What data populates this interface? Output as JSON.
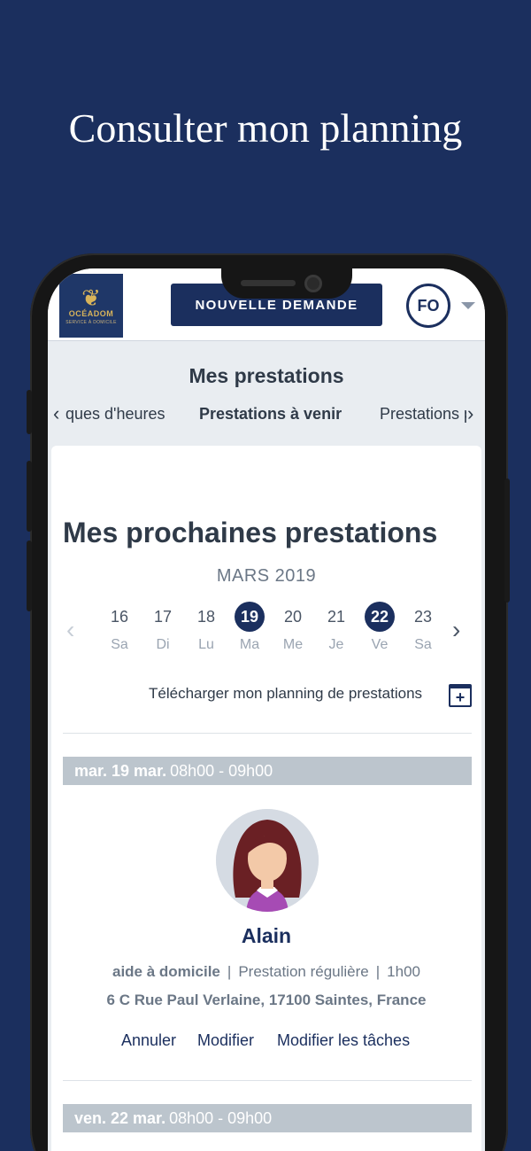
{
  "hero_title": "Consulter mon planning",
  "header": {
    "logo_name": "OCÉADOM",
    "logo_sub": "SERVICE À DOMICILE",
    "new_request_label": "NOUVELLE DEMANDE",
    "user_initials": "FO"
  },
  "subnav": {
    "title": "Mes prestations",
    "tabs": [
      {
        "label": "ques d'heures"
      },
      {
        "label": "Prestations à venir",
        "active": true
      },
      {
        "label": "Prestations p"
      }
    ]
  },
  "planning": {
    "heading": "Mes prochaines prestations",
    "month": "MARS 2019",
    "days": [
      {
        "num": "16",
        "label": "Sa",
        "selected": false
      },
      {
        "num": "17",
        "label": "Di",
        "selected": false
      },
      {
        "num": "18",
        "label": "Lu",
        "selected": false
      },
      {
        "num": "19",
        "label": "Ma",
        "selected": true
      },
      {
        "num": "20",
        "label": "Me",
        "selected": false
      },
      {
        "num": "21",
        "label": "Je",
        "selected": false
      },
      {
        "num": "22",
        "label": "Ve",
        "selected": true
      },
      {
        "num": "23",
        "label": "Sa",
        "selected": false
      }
    ],
    "download_label": "Télécharger mon planning de prestations"
  },
  "appointments": [
    {
      "date": "mar. 19 mar.",
      "time": "08h00 - 09h00",
      "worker": "Alain",
      "service": "aide à domicile",
      "type": "Prestation régulière",
      "duration": "1h00",
      "address": "6 C Rue Paul Verlaine, 17100 Saintes, France",
      "actions": [
        "Annuler",
        "Modifier",
        "Modifier les tâches"
      ]
    },
    {
      "date": "ven. 22 mar.",
      "time": "08h00 - 09h00"
    }
  ],
  "colors": {
    "background": "#1b2f5e",
    "primary": "#1b2f5e",
    "date_bar": "#bcc5cd"
  }
}
